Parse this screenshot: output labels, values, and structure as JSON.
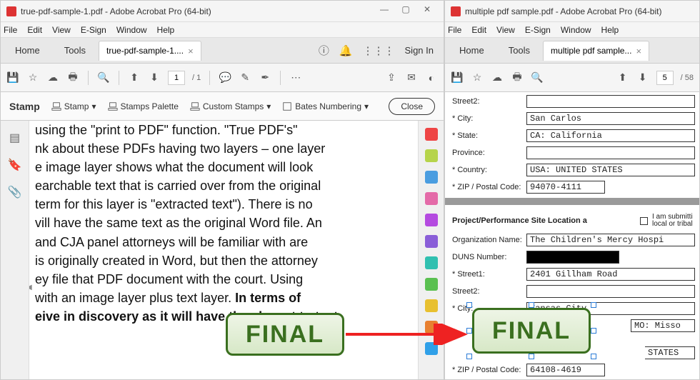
{
  "win1": {
    "title": "true-pdf-sample-1.pdf - Adobe Acrobat Pro (64-bit)",
    "menus": [
      "File",
      "Edit",
      "View",
      "E-Sign",
      "Window",
      "Help"
    ],
    "tabs": {
      "home": "Home",
      "tools": "Tools",
      "doc": "true-pdf-sample-1...."
    },
    "signin": "Sign In",
    "page_current": "1",
    "page_total": "/ 1",
    "stampbar": {
      "title": "Stamp",
      "stamp": "Stamp",
      "palette": "Stamps Palette",
      "custom": "Custom Stamps",
      "bates": "Bates Numbering",
      "close": "Close"
    },
    "doc_lines": [
      "using the \"print to PDF\" function. \"True PDF's\"",
      "nk about these PDFs having two layers – one layer",
      "e image layer shows what the document will look",
      "earchable text that is carried over from the original",
      "term for this layer is \"extracted text\"). There is no",
      "vill have the same text as the original Word file. An",
      "and CJA panel attorneys will be familiar with are",
      "is originally created in Word, but then the attorney",
      "ey file that PDF document with the court. Using",
      "with an image layer plus text layer."
    ],
    "doc_bold1": "In terms of",
    "doc_bold2": "eive in discovery as it will have the closest to text",
    "stamp_text": "FINAL"
  },
  "win2": {
    "title": "multiple pdf sample.pdf - Adobe Acrobat Pro (64-bit)",
    "menus": [
      "File",
      "Edit",
      "View",
      "E-Sign",
      "Window",
      "Help"
    ],
    "tabs": {
      "home": "Home",
      "tools": "Tools",
      "doc": "multiple pdf sample..."
    },
    "page_current": "5",
    "page_total": "/ 58",
    "form": {
      "street2_label": "Street2:",
      "city_label": "* City:",
      "city_val": "San Carlos",
      "state_label": "* State:",
      "state_val": "CA: California",
      "province_label": "Province:",
      "country_label": "* Country:",
      "country_val": "USA: UNITED STATES",
      "zip_label": "* ZIP / Postal Code:",
      "zip_val": "94070-4111",
      "section_title": "Project/Performance Site Location  a",
      "tribal_label": "I am submitti local or tribal",
      "org_label": "Organization Name:",
      "org_val": "The Children's Mercy Hospi",
      "duns_label": "DUNS Number:",
      "street1_label": "* Street1:",
      "street1_val": "2401 Gillham Road",
      "street2b_label": "Street2:",
      "city2_label": "* City:",
      "city2_val": "Kansas City",
      "mo_val": "MO: Misso",
      "states_val": "STATES",
      "zip2_label": "* ZIP / Postal Code:",
      "zip2_val": "64108-4619"
    },
    "stamp_text": "FINAL"
  }
}
